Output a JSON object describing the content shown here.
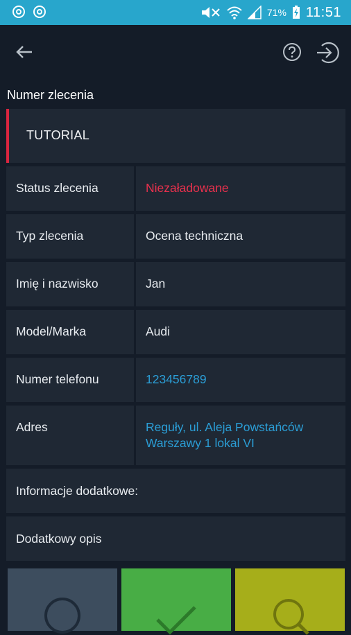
{
  "status_bar": {
    "battery_percent": "71%",
    "time": "11:51"
  },
  "app_bar": {
    "back_icon": "arrow-left-icon",
    "help_icon": "help-circle-icon",
    "logout_icon": "logout-icon"
  },
  "order": {
    "section_label": "Numer zlecenia",
    "number": "TUTORIAL",
    "rows": [
      {
        "label": "Status zlecenia",
        "value": "Niezaładowane",
        "color": "#e8314d"
      },
      {
        "label": "Typ zlecenia",
        "value": "Ocena techniczna"
      },
      {
        "label": "Imię i nazwisko",
        "value": "Jan"
      },
      {
        "label": "Model/Marka",
        "value": "Audi"
      },
      {
        "label": "Numer telefonu",
        "value": "123456789",
        "color": "#2b9ed6"
      },
      {
        "label": "Adres",
        "value_line1": "Reguły, ul. Aleja Powstańców",
        "value_line2": "Warszawy 1 lokal VI",
        "color": "#2b9ed6"
      }
    ],
    "extra_info_label": "Informacje dodatkowe:",
    "extra_info_value": "Dodatkowy opis"
  },
  "actions": [
    {
      "icon": "circle-icon",
      "color": "#3d4d5e"
    },
    {
      "icon": "check-icon",
      "color": "#48ad45"
    },
    {
      "icon": "search-icon",
      "color": "#a6ae1a"
    }
  ]
}
